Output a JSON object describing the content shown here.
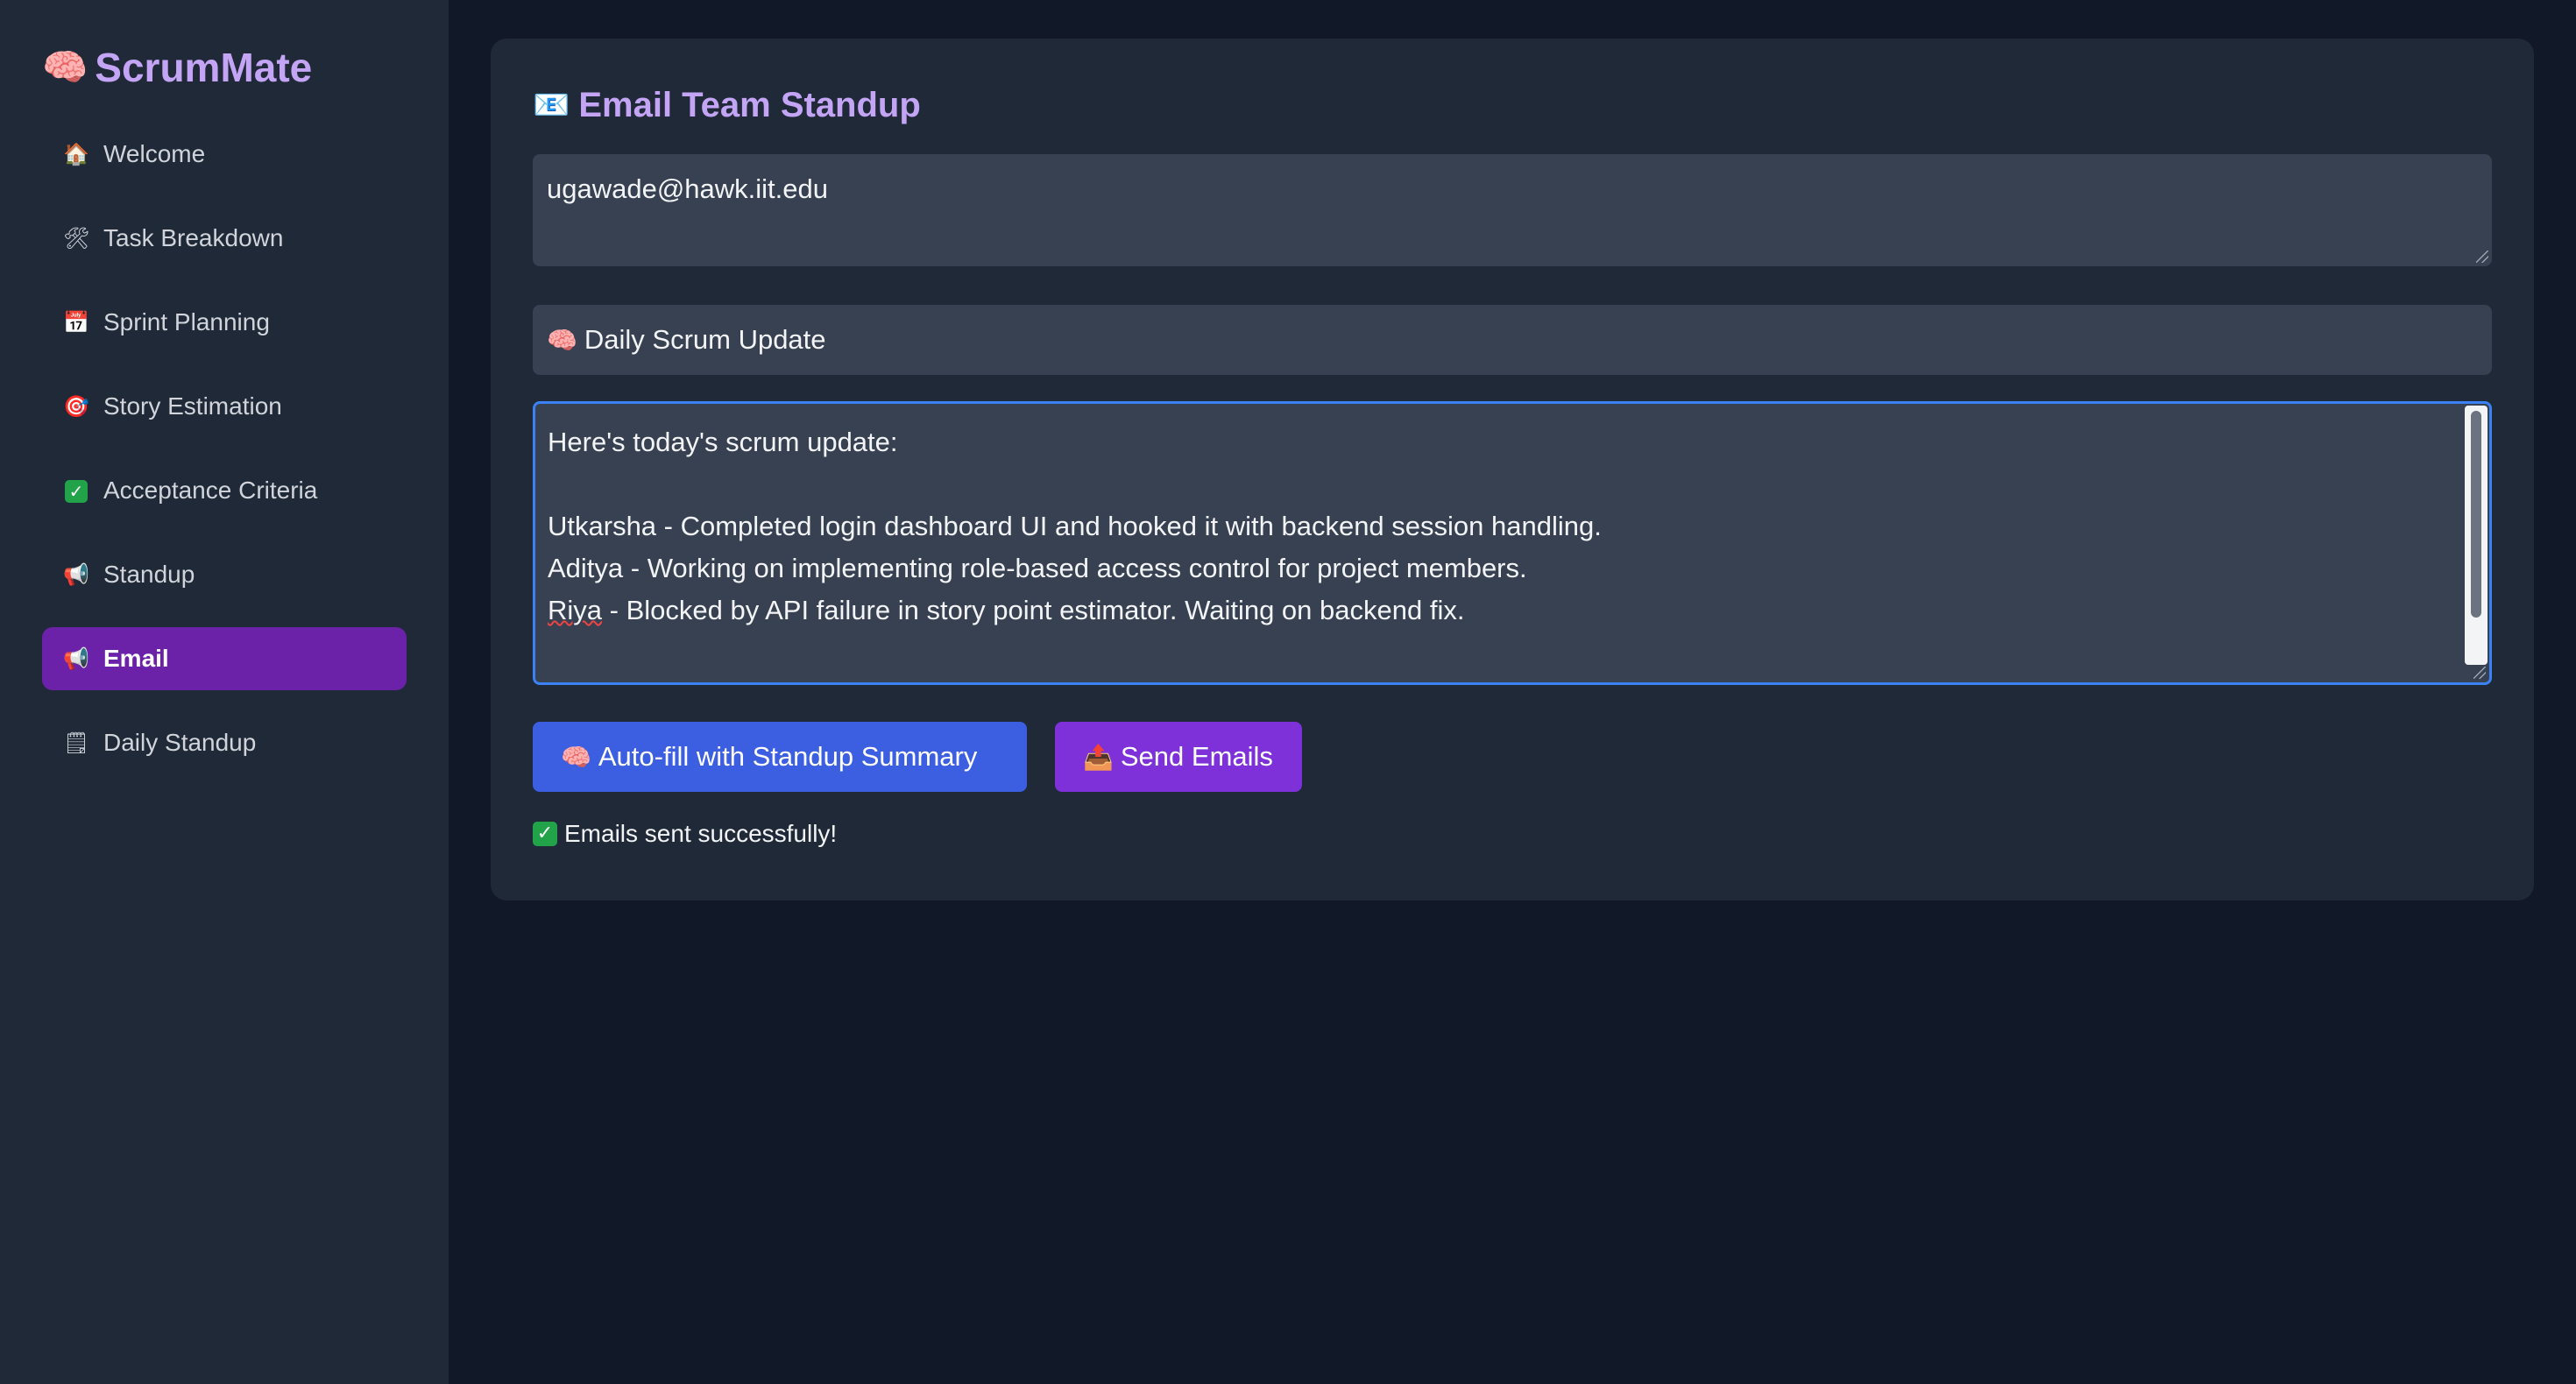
{
  "sidebar": {
    "brand": {
      "icon": "🧠",
      "name": "ScrumMate"
    },
    "items": [
      {
        "icon": "🏠",
        "label": "Welcome",
        "active": false
      },
      {
        "icon": "🛠",
        "label": "Task Breakdown",
        "active": false
      },
      {
        "icon": "📅",
        "label": "Sprint Planning",
        "active": false
      },
      {
        "icon": "🎯",
        "label": "Story Estimation",
        "active": false
      },
      {
        "icon": "✓",
        "label": "Acceptance Criteria",
        "active": false
      },
      {
        "icon": "📢",
        "label": "Standup",
        "active": false
      },
      {
        "icon": "📢",
        "label": "Email",
        "active": true
      },
      {
        "icon": "🗒",
        "label": "Daily Standup",
        "active": false
      }
    ]
  },
  "main": {
    "title_icon": "📧",
    "title": "Email Team Standup",
    "recipients_value": "ugawade@hawk.iit.edu",
    "subject_icon": "🧠",
    "subject_value": "Daily Scrum Update",
    "body_lines": [
      "Here's today's scrum update:",
      "",
      "Utkarsha - Completed login dashboard UI and hooked it with backend session handling.",
      "Aditya - Working on implementing role-based access control for project members.",
      "Riya",
      " - Blocked by API failure in story point estimator. Waiting on backend fix."
    ],
    "buttons": {
      "autofill_icon": "🧠",
      "autofill_label": "Auto-fill with Standup Summary",
      "send_icon": "📤",
      "send_label": "Send Emails"
    },
    "status": {
      "icon": "✓",
      "text": "Emails sent successfully!"
    }
  },
  "colors": {
    "background": "#111827",
    "panel": "#1f2937",
    "field": "#374151",
    "accent_purple": "#c4a5f5",
    "active_nav": "#6b21a8",
    "autofill_button": "#3b5fe0",
    "send_button": "#7e30d9",
    "focus_border": "#3b82f6",
    "success": "#22a34a"
  }
}
